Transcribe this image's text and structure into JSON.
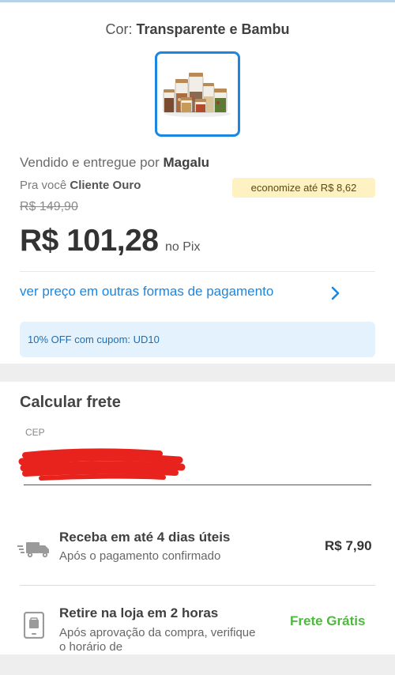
{
  "variant": {
    "color_label": "Cor:",
    "color_value": "Transparente e Bambu"
  },
  "seller": {
    "prefix": "Vendido e entregue por",
    "name": "Magalu"
  },
  "club": {
    "prefix": "Pra você",
    "name": "Cliente Ouro"
  },
  "economize": "economize até R$ 8,62",
  "pricing": {
    "old_price": "R$ 149,90",
    "price": "R$ 101,28",
    "method": "no Pix",
    "other_payments_link": "ver preço em outras formas de pagamento"
  },
  "coupon": "10% OFF com cupom: UD10",
  "shipping": {
    "title": "Calcular frete",
    "cep_label": "CEP",
    "cep_value": "",
    "options": [
      {
        "title": "Receba em até 4 dias úteis",
        "subtitle": "Após o pagamento confirmado",
        "price": "R$ 7,90",
        "icon": "delivery-truck-icon"
      },
      {
        "title": "Retire na loja em 2 horas",
        "subtitle": "Após aprovação da compra, verifique o horário de",
        "price": "Frete Grátis",
        "icon": "store-pickup-icon"
      }
    ]
  },
  "colors": {
    "accent_blue": "#1b87e0",
    "free_green": "#4fb83f",
    "economize_bg": "#fef2c3",
    "coupon_bg": "#e4f2fd",
    "redaction_red": "#e8231e"
  }
}
